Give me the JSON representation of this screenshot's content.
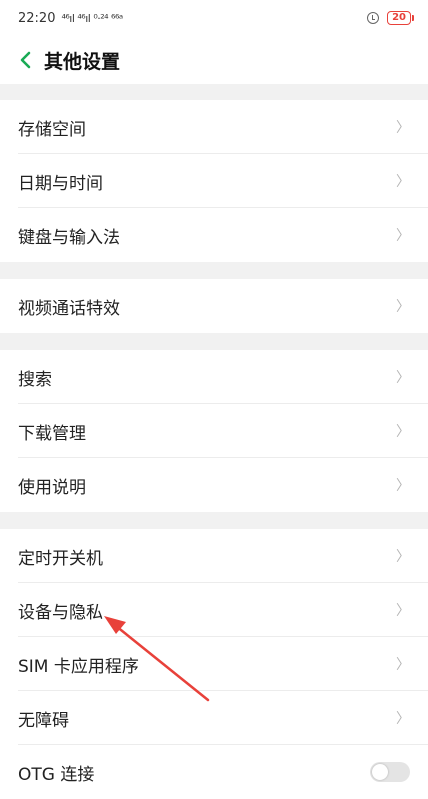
{
  "status_bar": {
    "time": "22:20",
    "signals": "⁴⁶ıl ⁴⁶ıl ⁰·²⁴ ⁶⁶ᵃ",
    "battery": "20",
    "colors": {
      "battery": "#e8413a"
    }
  },
  "header": {
    "title": "其他设置",
    "back_icon": "chevron-left-icon",
    "back_color": "#1aaa55"
  },
  "groups": [
    {
      "items": [
        {
          "label": "存储空间",
          "trailing": "chevron"
        },
        {
          "label": "日期与时间",
          "trailing": "chevron"
        },
        {
          "label": "键盘与输入法",
          "trailing": "chevron"
        }
      ]
    },
    {
      "items": [
        {
          "label": "视频通话特效",
          "trailing": "chevron"
        }
      ]
    },
    {
      "items": [
        {
          "label": "搜索",
          "trailing": "chevron"
        },
        {
          "label": "下载管理",
          "trailing": "chevron"
        },
        {
          "label": "使用说明",
          "trailing": "chevron"
        }
      ]
    },
    {
      "items": [
        {
          "label": "定时开关机",
          "trailing": "chevron"
        },
        {
          "label": "设备与隐私",
          "trailing": "chevron"
        },
        {
          "label": "SIM 卡应用程序",
          "trailing": "chevron"
        },
        {
          "label": "无障碍",
          "trailing": "chevron"
        },
        {
          "label": "OTG 连接",
          "trailing": "toggle",
          "toggle_on": false
        }
      ]
    }
  ],
  "chevron_glyph": "〉",
  "annotation": {
    "color": "#e8413a",
    "target": "设备与隐私"
  }
}
